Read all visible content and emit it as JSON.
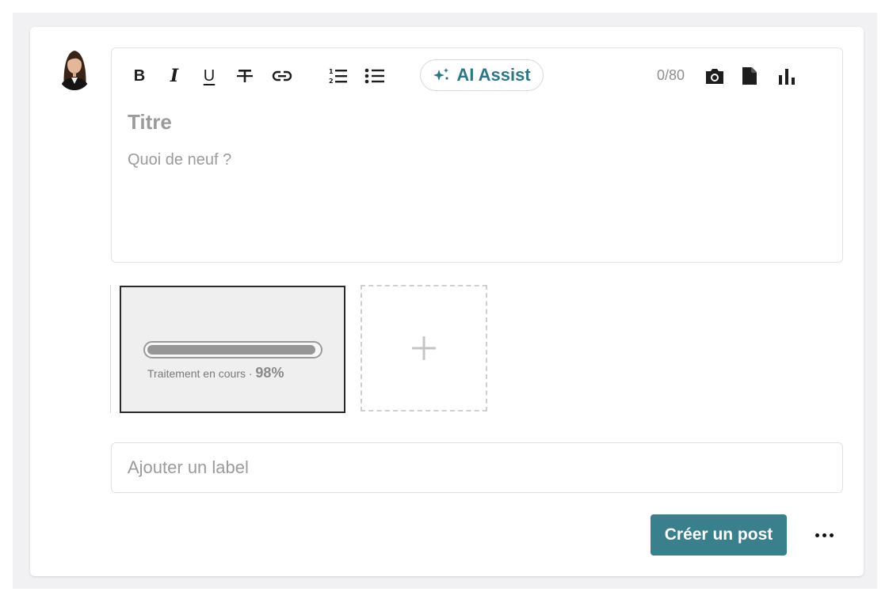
{
  "composer": {
    "toolbar": {
      "bold_label": "B",
      "italic_label": "I",
      "underline_label": "U",
      "strike_icon": "strikethrough-icon",
      "link_icon": "link-icon",
      "ordered_list_icon": "ordered-list-icon",
      "bullet_list_icon": "bullet-list-icon",
      "ai_assist_label": "AI Assist",
      "ai_assist_icon": "sparkle-icon",
      "char_counter": "0/80",
      "camera_icon": "camera-icon",
      "file_icon": "file-icon",
      "chart_icon": "bar-chart-icon"
    },
    "title_placeholder": "Titre",
    "body_placeholder": "Quoi de neuf ?",
    "attachment": {
      "status_label": "Traitement en cours ·",
      "progress_value": "98%",
      "progress_fraction": 0.98
    },
    "add_attachment_icon": "plus-icon",
    "label_input": {
      "placeholder": "Ajouter un label",
      "value": ""
    },
    "submit_label": "Créer un post",
    "more_icon": "more-horizontal-icon"
  },
  "colors": {
    "accent": "#3a7f8c",
    "ai_accent": "#2e7686",
    "placeholder": "#9b9b9b",
    "background": "#f1f1f3"
  }
}
